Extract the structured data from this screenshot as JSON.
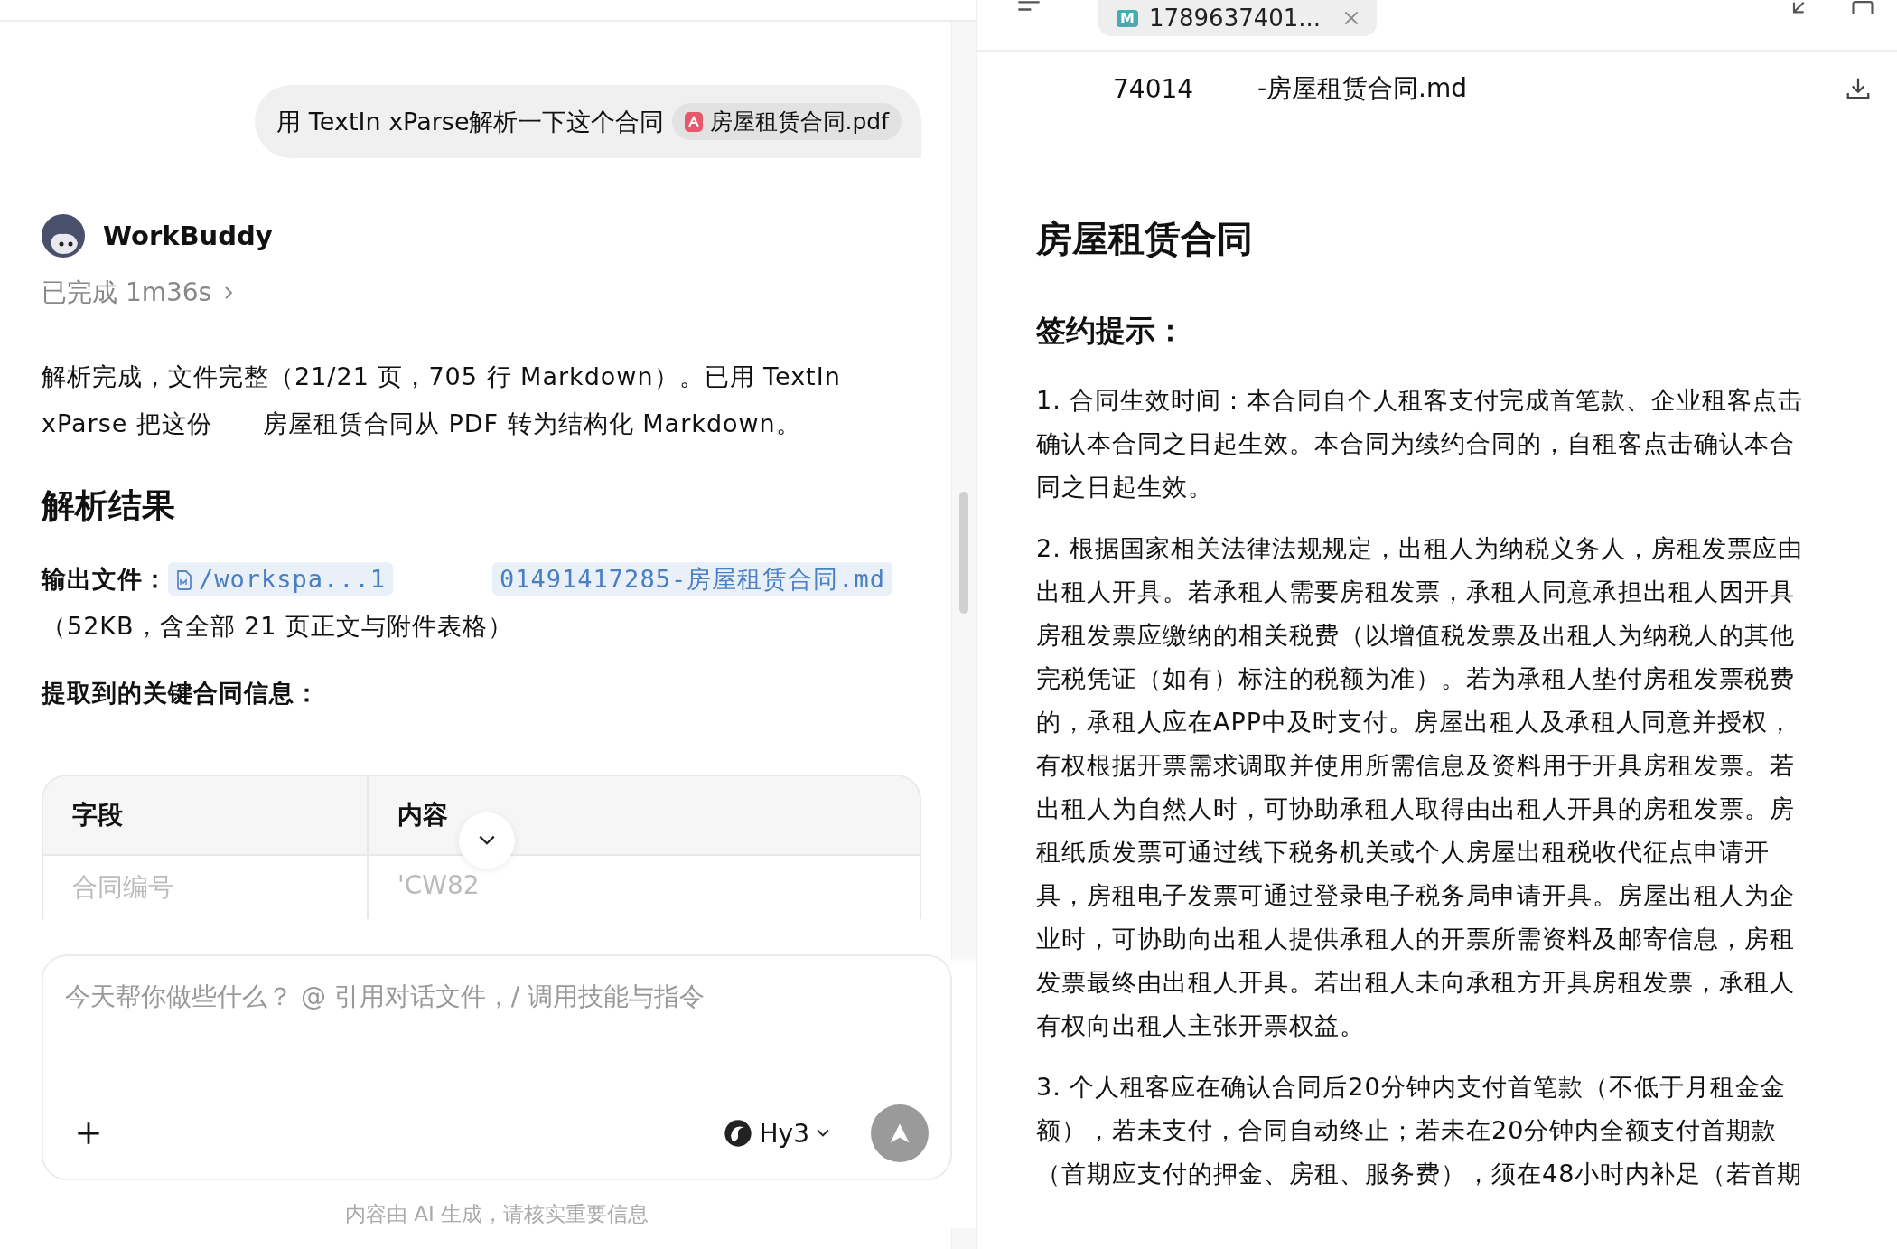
{
  "chat": {
    "user_message": {
      "text": "用 TextIn xParse解析一下这个合同",
      "attachment": "房屋租赁合同.pdf"
    },
    "assistant": {
      "name": "WorkBuddy",
      "status": "已完成 1m36s",
      "intro": "解析完成，文件完整（21/21 页，705 行 Markdown）。已用 TextIn xParse 把这份　　房屋租赁合同从 PDF 转为结构化 Markdown。",
      "heading": "解析结果",
      "output_label": "输出文件：",
      "output_link_start": "/workspa...1",
      "output_link_end": "01491417285-房屋租赁合同.md",
      "output_note": "（52KB，含全部 21 页正文与附件表格）",
      "extract_label": "提取到的关键合同信息：",
      "table": {
        "columns": [
          "字段",
          "内容"
        ],
        "rows": [
          [
            "合同编号",
            "'CW82"
          ]
        ]
      }
    }
  },
  "composer": {
    "placeholder": "今天帮你做些什么？ @ 引用对话文件，/ 调用技能与指令",
    "model": "Hy3",
    "disclaimer": "内容由 AI 生成，请核实重要信息"
  },
  "viewer": {
    "tab": {
      "badge": "M",
      "label": "1789637401...",
      "selected": true
    },
    "file_name_start": "74014",
    "file_name_end": "-房屋租赁合同.md",
    "title": "房屋租赁合同",
    "subtitle": "签约提示：",
    "paragraphs": [
      "1.  合同生效时间：本合同自个人租客支付完成首笔款、企业租客点击确认本合同之日起生效。本合同为续约合同的，自租客点击确认本合同之日起生效。",
      "2.  根据国家相关法律法规规定，出租人为纳税义务人，房租发票应由出租人开具。若承租人需要房租发票，承租人同意承担出租人因开具房租发票应缴纳的相关税费（以增值税发票及出租人为纳税人的其他完税凭证（如有）标注的税额为准）。若为承租人垫付房租发票税费的，承租人应在APP中及时支付。房屋出租人及承租人同意并授权，有权根据开票需求调取并使用所需信息及资料用于开具房租发票。若出租人为自然人时，可协助承租人取得由出租人开具的房租发票。房租纸质发票可通过线下税务机关或个人房屋出租税收代征点申请开具，房租电子发票可通过登录电子税务局申请开具。房屋出租人为企业时，可协助向出租人提供承租人的开票所需资料及邮寄信息，房租发票最终由出租人开具。若出租人未向承租方开具房租发票，承租人有权向出租人主张开票权益。",
      "3.  个人租客应在确认合同后20分钟内支付首笔款（不低于月租金金额），若未支付，合同自动终止；若未在20分钟内全额支付首期款（首期应支付的押金、房租、服务费），须在48小时内补足（若首期"
    ]
  }
}
